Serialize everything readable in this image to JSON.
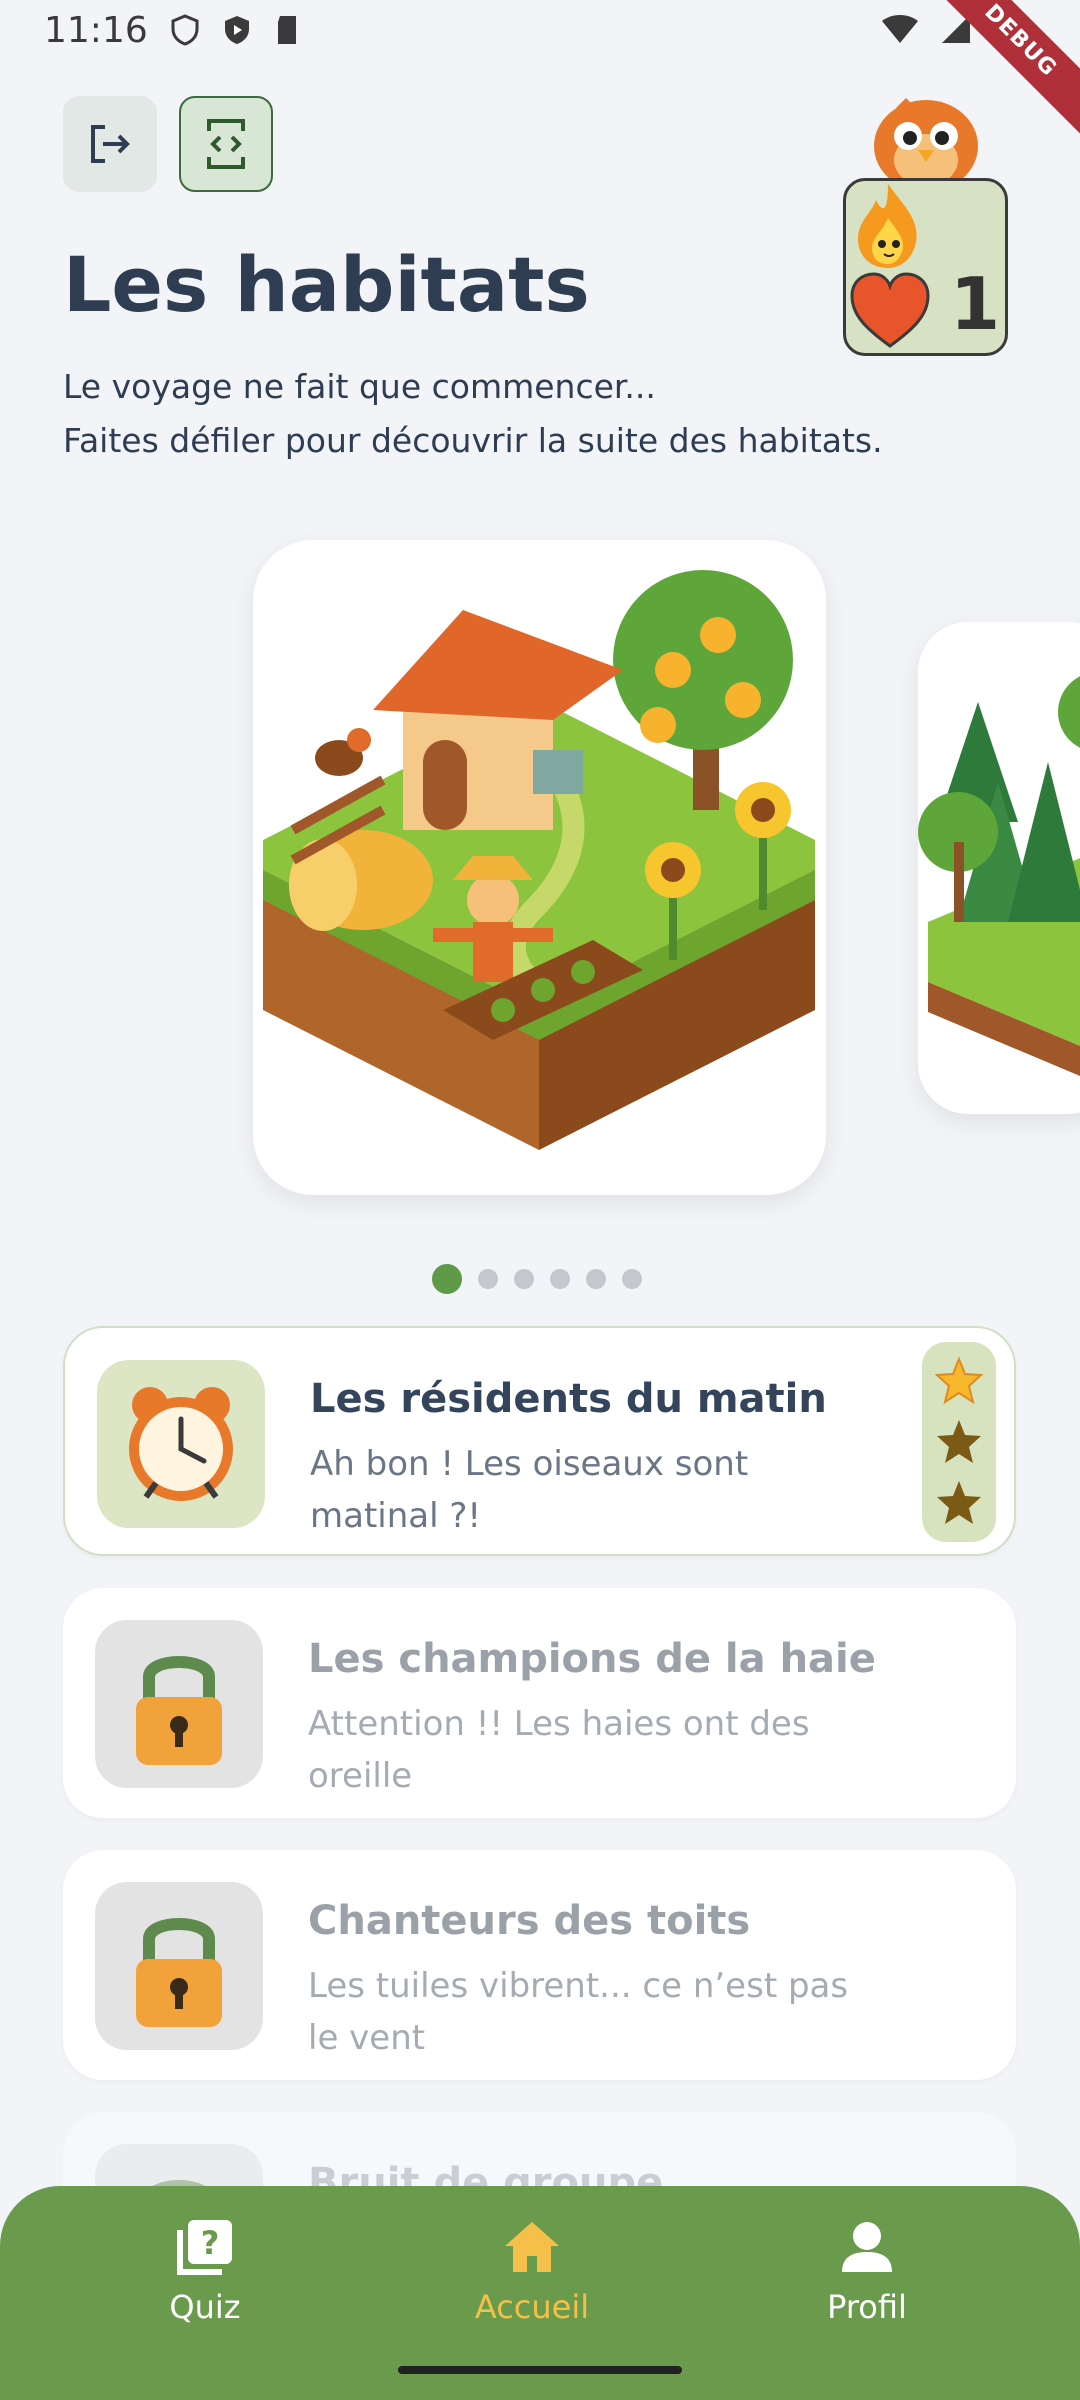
{
  "status_bar": {
    "time": "11:16",
    "debug_label": "DEBUG"
  },
  "header": {
    "title": "Les habitats",
    "subtitle_line1": "Le voyage ne fait que commencer...",
    "subtitle_line2": "Faites défiler pour découvrir la suite des habitats.",
    "hearts_count": "1"
  },
  "carousel": {
    "page_count": 6,
    "active_index": 0
  },
  "levels": [
    {
      "title": "Les résidents du matin",
      "desc_line1": "Ah bon ! Les oiseaux sont",
      "desc_line2": "matinal ?!",
      "stars_earned": 1,
      "stars_total": 3,
      "locked": false
    },
    {
      "title": "Les champions de la haie",
      "desc_line1": "Attention !! Les haies ont des",
      "desc_line2": "oreille",
      "locked": true
    },
    {
      "title": "Chanteurs des toits",
      "desc_line1": "Les tuiles vibrent... ce n’est pas",
      "desc_line2": "le vent",
      "locked": true
    },
    {
      "title": "Bruit de groupe",
      "locked": true
    }
  ],
  "nav": {
    "items": [
      {
        "label": "Quiz",
        "icon": "quiz-icon"
      },
      {
        "label": "Accueil",
        "icon": "home-icon"
      },
      {
        "label": "Profil",
        "icon": "profile-icon"
      }
    ],
    "active_index": 1,
    "active_color": "#F5C04A",
    "bg_color": "#6A9A4C"
  }
}
